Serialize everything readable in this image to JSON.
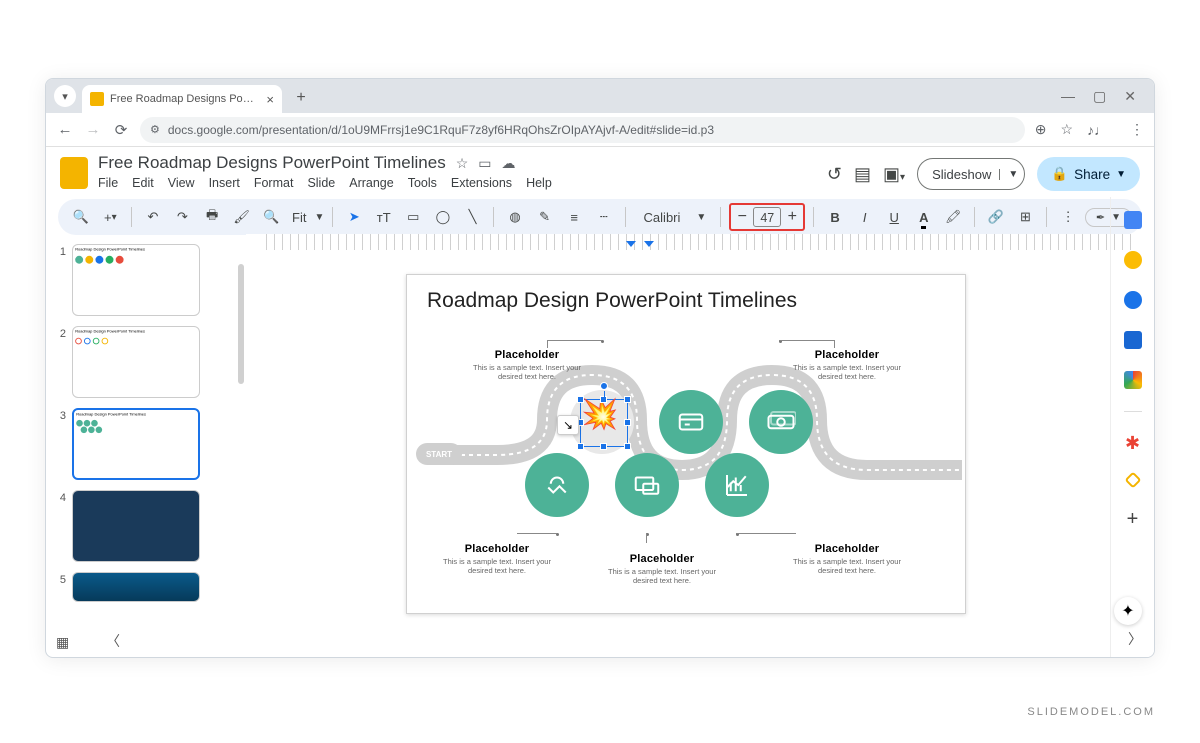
{
  "browser": {
    "tab_title": "Free Roadmap Designs PowerP...",
    "url": "docs.google.com/presentation/d/1oU9MFrrsj1e9C1RquF7z8yf6HRqOhsZrOIpAYAjvf-A/edit#slide=id.p3"
  },
  "app": {
    "doc_title": "Free Roadmap Designs PowerPoint Timelines",
    "menus": [
      "File",
      "Edit",
      "View",
      "Insert",
      "Format",
      "Slide",
      "Arrange",
      "Tools",
      "Extensions",
      "Help"
    ],
    "slideshow_label": "Slideshow",
    "share_label": "Share"
  },
  "toolbar": {
    "zoom_label": "Fit",
    "font_name": "Calibri",
    "font_size": "47"
  },
  "filmstrip": {
    "selected": 3,
    "count": 5
  },
  "slide": {
    "title": "Roadmap Design PowerPoint Timelines",
    "start_label": "START",
    "placeholders": [
      {
        "title": "Placeholder",
        "sub": "This is a sample text. Insert your desired text here."
      },
      {
        "title": "Placeholder",
        "sub": "This is a sample text. Insert your desired text here."
      },
      {
        "title": "Placeholder",
        "sub": "This is a sample text. Insert your desired text here."
      },
      {
        "title": "Placeholder",
        "sub": "This is a sample text. Insert your desired text here."
      },
      {
        "title": "Placeholder",
        "sub": "This is a sample text. Insert your desired text here."
      }
    ]
  },
  "watermark": "SLIDEMODEL.COM"
}
